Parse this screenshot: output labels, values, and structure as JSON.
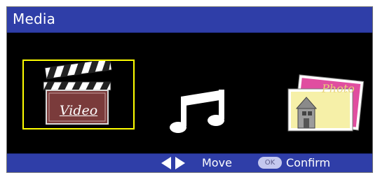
{
  "window": {
    "title": "Media"
  },
  "media_items": [
    {
      "label": "Video",
      "icon": "clapperboard-icon",
      "selected": true
    },
    {
      "label": "",
      "icon": "music-note-icon",
      "selected": false
    },
    {
      "label": "Photo",
      "icon": "photo-icon",
      "selected": false
    }
  ],
  "footer": {
    "move_label": "Move",
    "ok_label": "OK",
    "confirm_label": "Confirm"
  },
  "colors": {
    "bar_blue": "#2f3ea8",
    "selection": "#ffff00",
    "video_card": "#7a3b3b",
    "photo_card": "#f6f0a8"
  }
}
